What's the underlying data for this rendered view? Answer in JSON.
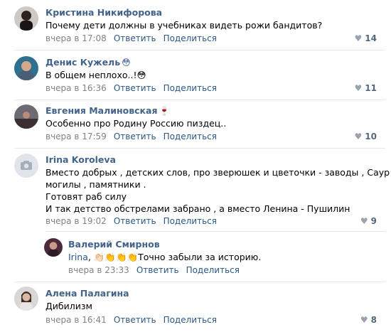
{
  "comments": [
    {
      "author": "Кристина Никифорова",
      "author_emoji": "",
      "text_lines": [
        "Почему дети должны в учебниках видеть рожи бандитов?"
      ],
      "time": "вчера в 17:08",
      "reply_label": "Ответить",
      "share_label": "Поделиться",
      "likes": "14"
    },
    {
      "author": "Денис Кужель",
      "author_emoji": "😳",
      "text_lines": [
        "В общем неплохо..!😳"
      ],
      "time": "вчера в 16:36",
      "reply_label": "Ответить",
      "share_label": "Поделиться",
      "likes": "11"
    },
    {
      "author": "Евгения Малиновская",
      "author_emoji": "🍷",
      "text_lines": [
        "Особенно про Родину Россию пиздец.."
      ],
      "time": "вчера в 17:59",
      "reply_label": "Ответить",
      "share_label": "Поделиться",
      "likes": "10"
    },
    {
      "author": "Irina Koroleva",
      "author_emoji": "",
      "text_lines": [
        "Вместо добрых , детских слов, про зверюшек и цветочки - заводы , Саур -",
        "могилы , памятники .",
        "Готовят раб силу",
        "И так детство обстрелами забрано , а вместо Ленина - Пушилин"
      ],
      "time": "вчера в 19:02",
      "reply_label": "Ответить",
      "share_label": "Поделиться",
      "likes": "9"
    },
    {
      "author": "Валерий Смирнов",
      "author_emoji": "",
      "reply_to": "Irina",
      "text_lines": [
        ", 👏🏻👏👏👏Точно забыли за историю."
      ],
      "time": "вчера в 23:33",
      "reply_label": "Ответить",
      "share_label": "Поделиться",
      "likes": ""
    },
    {
      "author": "Алена Палагина",
      "author_emoji": "",
      "text_lines": [
        "Дибилизм"
      ],
      "time": "вчера в 16:41",
      "reply_label": "Ответить",
      "share_label": "Поделиться",
      "likes": "8"
    }
  ],
  "colors": {
    "author": "#42648b",
    "link": "#2a5885",
    "meta": "#828282",
    "likes": "#55677d",
    "divider": "#e7e8ec"
  }
}
